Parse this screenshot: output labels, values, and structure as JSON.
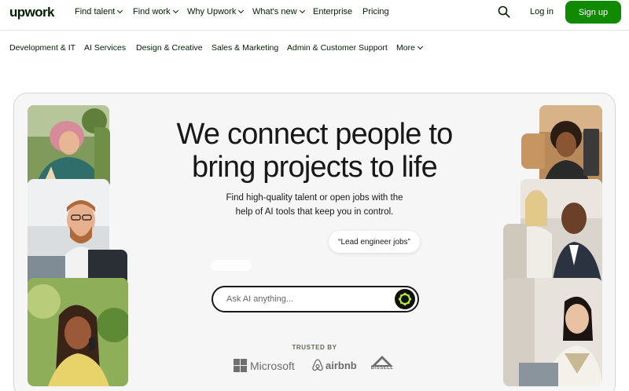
{
  "brand": {
    "logo_text": "upwork"
  },
  "nav": {
    "items": [
      {
        "label": "Find talent",
        "has_dropdown": true
      },
      {
        "label": "Find work",
        "has_dropdown": true
      },
      {
        "label": "Why Upwork",
        "has_dropdown": true
      },
      {
        "label": "What's new",
        "has_dropdown": true
      },
      {
        "label": "Enterprise",
        "has_dropdown": false
      },
      {
        "label": "Pricing",
        "has_dropdown": false
      }
    ],
    "search_icon": "search-icon",
    "login_label": "Log in",
    "signup_label": "Sign up"
  },
  "categories": [
    "Development & IT",
    "AI Services",
    "Design & Creative",
    "Sales & Marketing",
    "Admin & Customer Support",
    "More"
  ],
  "hero": {
    "headline_line1": "We connect people to",
    "headline_line2": "bring projects to life",
    "sub_line1": "Find high-quality talent or open jobs with the",
    "sub_line2": "help of AI tools that keep you in control.",
    "suggestion_chip": "“Lead engineer jobs”",
    "ask_placeholder": "Ask AI anything...",
    "trusted_by_label": "TRUSTED BY",
    "trusted_brands": [
      "Microsoft",
      "airbnb",
      "BISSELL"
    ]
  },
  "colors": {
    "brand_green": "#108a00",
    "text_dark": "#001e00",
    "hero_bg": "#f6f6f6"
  }
}
